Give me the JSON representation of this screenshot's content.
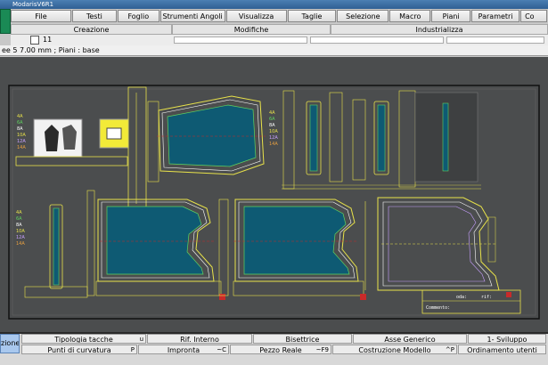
{
  "window": {
    "title": "ModarisV6R1"
  },
  "menu": [
    "File",
    "Testi",
    "Foglio",
    "Strumenti Angoli",
    "Visualizza",
    "Taglie",
    "Selezione",
    "Macro",
    "Piani",
    "Parametri",
    "Co"
  ],
  "groups": [
    "Creazione",
    "Modifiche",
    "Industrializza"
  ],
  "toolbar": {
    "count": "11"
  },
  "info": {
    "text": "ee 5 7.00 mm  ;  Piani : base"
  },
  "sizes": [
    "4A",
    "6A",
    "8A",
    "10A",
    "12A",
    "14A"
  ],
  "title_block": {
    "oda": "oda:",
    "rif": "rif:",
    "commento": "Commento:"
  },
  "bottom": {
    "left_label": "zione",
    "row1": [
      {
        "label": "Tipologia tacche",
        "shortcut": "u"
      },
      {
        "label": "Rif. Interno",
        "shortcut": ""
      },
      {
        "label": "Bisettrice",
        "shortcut": ""
      },
      {
        "label": "Asse Generico",
        "shortcut": ""
      },
      {
        "label": "1- Sviluppo",
        "shortcut": ""
      }
    ],
    "row2": [
      {
        "label": "Punti di curvatura",
        "shortcut": "P"
      },
      {
        "label": "Impronta",
        "shortcut": "~C"
      },
      {
        "label": "Pezzo Reale",
        "shortcut": "~F9"
      },
      {
        "label": "Costruzione Modello",
        "shortcut": "^P"
      },
      {
        "label": "Ordinamento utenti",
        "shortcut": ""
      }
    ]
  },
  "colors": {
    "workspace": "#4b4d4e",
    "piece_fill": "#0e5a73",
    "yellow": "#e8e24a",
    "green": "#5fd35f",
    "red": "#c82a2a"
  }
}
